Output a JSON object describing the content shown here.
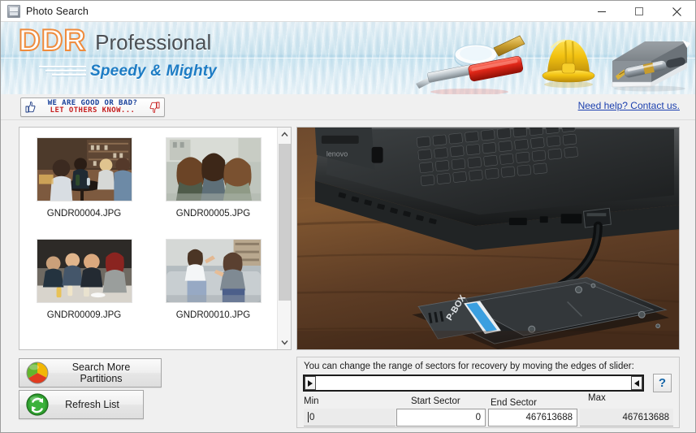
{
  "window": {
    "title": "Photo Search",
    "icon": "app-icon",
    "controls": {
      "minimize": "minimize",
      "maximize": "maximize",
      "close": "close"
    }
  },
  "banner": {
    "brand": "DDR",
    "product": "Professional",
    "tagline": "Speedy & Mighty",
    "brand_color": "#ef8b3c",
    "product_color": "#4b4f54",
    "tagline_color": "#1d7cc4"
  },
  "linkbar": {
    "feedback_line1": "WE ARE GOOD OR BAD?",
    "feedback_line2": "LET OTHERS KNOW...",
    "feedback_line1_color": "#18409a",
    "feedback_line2_color": "#c62020",
    "help_link": "Need help? Contact us.",
    "help_link_color": "#1b3fae"
  },
  "filelist": {
    "files": [
      {
        "name": "GNDR00004.JPG",
        "thumb": "friends-at-bar-table"
      },
      {
        "name": "GNDR00005.JPG",
        "thumb": "three-women-hugging"
      },
      {
        "name": "GNDR00009.JPG",
        "thumb": "friends-at-cafe"
      },
      {
        "name": "GNDR00010.JPG",
        "thumb": "two-women-on-couch"
      }
    ],
    "scroll_up": "scroll-up",
    "scroll_down": "scroll-down"
  },
  "preview": {
    "description": "laptop-with-usb-external-hard-drive-on-wooden-desk",
    "device_label": "P-BOX"
  },
  "actions": {
    "search_more_partitions": "Search More Partitions",
    "refresh_list": "Refresh List"
  },
  "sector_panel": {
    "hint": "You can change the range of sectors for recovery by moving the edges of slider:",
    "help_button": "?",
    "labels": {
      "min": "Min",
      "start_sector": "Start Sector",
      "end_sector": "End Sector",
      "max": "Max"
    },
    "values": {
      "min": "0",
      "start_sector": "0",
      "end_sector": "467613688",
      "max": "467613688"
    }
  }
}
